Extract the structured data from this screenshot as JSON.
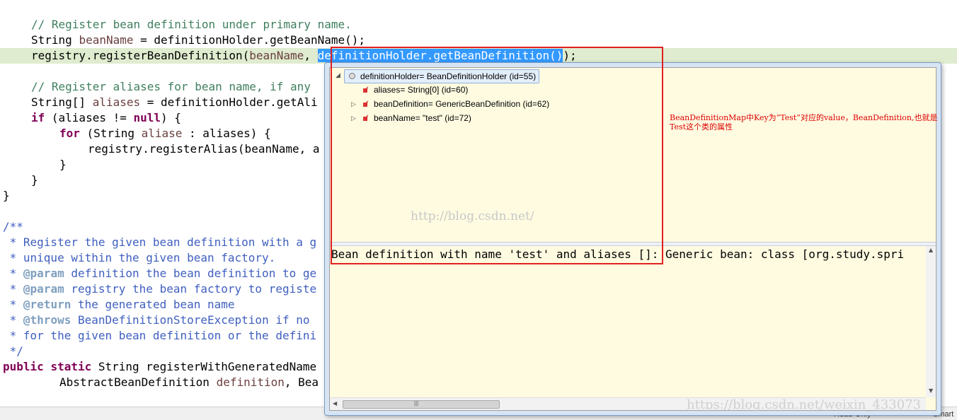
{
  "code": {
    "line1_comment": "// Register bean definition under primary name.",
    "line2": {
      "type": "String",
      "var": "beanName",
      "rest": " = definitionHolder.getBeanName();"
    },
    "line3": {
      "call": "registry.registerBeanDefinition(",
      "var": "beanName",
      "sep": ", ",
      "selected": "definitionHolder.getBeanDefinition()",
      "end": ");"
    },
    "line4_comment": "// Register aliases for bean name, if any",
    "line5": {
      "type": "String[]",
      "var": "aliases",
      "rest": " = definitionHolder.getAli"
    },
    "line6": {
      "kw": "if",
      "a": " (aliases != ",
      "null": "null",
      "b": ") {"
    },
    "line7": {
      "kw": "for",
      "a": " (String ",
      "var": "aliase",
      "b": " : aliases) {"
    },
    "line8": "registry.registerAlias(beanName, a",
    "line9": "}",
    "line10": "}",
    "line11": "}",
    "jd_open": "/**",
    "jd1": " * Register the given bean definition with a g",
    "jd2": " * unique within the given bean factory.",
    "jd3": {
      "tag": "@param",
      "text": " definition the bean definition to ge"
    },
    "jd4": {
      "tag": "@param",
      "text": " registry the bean factory to registe"
    },
    "jd5": {
      "tag": "@return",
      "text": " the generated bean name"
    },
    "jd6": {
      "tag": "@throws",
      "text": " BeanDefinitionStoreException if no"
    },
    "jd7": " * for the given bean definition or the defini",
    "jd_close": " */",
    "sig": {
      "kw1": "public",
      "kw2": "static",
      "rest": " String registerWithGeneratedName"
    },
    "sig2": {
      "type": "AbstractBeanDefinition ",
      "var": "definition",
      "rest": ", Bea"
    }
  },
  "popup": {
    "root": "definitionHolder= BeanDefinitionHolder  (id=55)",
    "children": [
      {
        "label": "aliases= String[0]  (id=60)",
        "expandable": false
      },
      {
        "label": "beanDefinition= GenericBeanDefinition  (id=62)",
        "expandable": true
      },
      {
        "label": "beanName= \"test\" (id=72)",
        "expandable": true
      }
    ],
    "detail": "Bean definition with name 'test' and aliases []: Generic bean: class [org.study.spri"
  },
  "annotation": "BeanDefinitionMap中Key为“Test”对应的value，BeanDefinition,也就是Test这个类的属性",
  "watermark1": "http://blog.csdn.net/",
  "watermark2": "https://blog.csdn.net/weixin_433073",
  "status": {
    "left": "Read-Only",
    "right": "Smart"
  }
}
